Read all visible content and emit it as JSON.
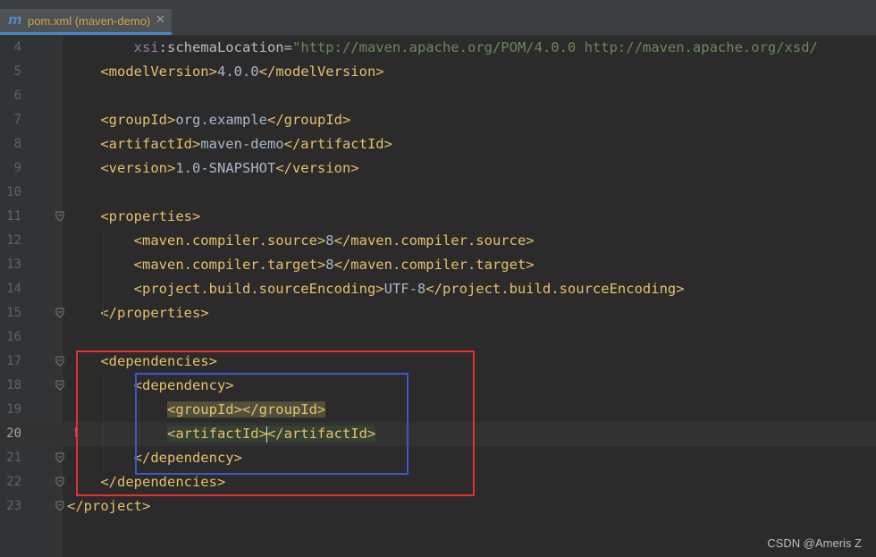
{
  "tab": {
    "icon": "m",
    "title": "pom.xml (maven-demo)",
    "close": "✕"
  },
  "lines": [
    {
      "n": "4",
      "parts": [
        [
          "ns",
          "        xsi"
        ],
        [
          "attr",
          ":schemaLocation"
        ],
        [
          "txt",
          "="
        ],
        [
          "str",
          "\"http://maven.apache.org/POM/4.0.0 http://maven.apache.org/xsd/"
        ]
      ]
    },
    {
      "n": "5",
      "parts": [
        [
          "tag",
          "    <modelVersion>"
        ],
        [
          "txt",
          "4.0.0"
        ],
        [
          "tag",
          "</modelVersion>"
        ]
      ]
    },
    {
      "n": "6",
      "parts": []
    },
    {
      "n": "7",
      "parts": [
        [
          "tag",
          "    <groupId>"
        ],
        [
          "txt",
          "org.example"
        ],
        [
          "tag",
          "</groupId>"
        ]
      ]
    },
    {
      "n": "8",
      "parts": [
        [
          "tag",
          "    <artifactId>"
        ],
        [
          "txt",
          "maven-demo"
        ],
        [
          "tag",
          "</artifactId>"
        ]
      ]
    },
    {
      "n": "9",
      "parts": [
        [
          "tag",
          "    <version>"
        ],
        [
          "txt",
          "1.0-SNAPSHOT"
        ],
        [
          "tag",
          "</version>"
        ]
      ]
    },
    {
      "n": "10",
      "parts": []
    },
    {
      "n": "11",
      "parts": [
        [
          "tag",
          "    <properties>"
        ]
      ]
    },
    {
      "n": "12",
      "parts": [
        [
          "tag",
          "        <maven.compiler.source>"
        ],
        [
          "txt",
          "8"
        ],
        [
          "tag",
          "</maven.compiler.source>"
        ]
      ]
    },
    {
      "n": "13",
      "parts": [
        [
          "tag",
          "        <maven.compiler.target>"
        ],
        [
          "txt",
          "8"
        ],
        [
          "tag",
          "</maven.compiler.target>"
        ]
      ]
    },
    {
      "n": "14",
      "parts": [
        [
          "tag",
          "        <project.build.sourceEncoding>"
        ],
        [
          "txt",
          "UTF-8"
        ],
        [
          "tag",
          "</project.build.sourceEncoding>"
        ]
      ]
    },
    {
      "n": "15",
      "parts": [
        [
          "tag",
          "    </properties>"
        ]
      ]
    },
    {
      "n": "16",
      "parts": []
    },
    {
      "n": "17",
      "parts": [
        [
          "tag",
          "    <dependencies>"
        ]
      ]
    },
    {
      "n": "18",
      "parts": [
        [
          "tag",
          "        <dependency>"
        ]
      ]
    },
    {
      "n": "19",
      "parts": [
        [
          "txt",
          "            "
        ],
        [
          "tag hl1",
          "<groupId></groupId>"
        ]
      ]
    },
    {
      "n": "20",
      "parts": [
        [
          "txt",
          "            "
        ],
        [
          "tag hl2",
          "<artifactId>"
        ],
        [
          "caret",
          ""
        ],
        [
          "tag hl2",
          "</artifactId>"
        ]
      ]
    },
    {
      "n": "21",
      "parts": [
        [
          "tag",
          "        </dependency>"
        ]
      ]
    },
    {
      "n": "22",
      "parts": [
        [
          "tag",
          "    </dependencies>"
        ]
      ]
    },
    {
      "n": "23",
      "parts": [
        [
          "tag",
          "</project>"
        ]
      ]
    }
  ],
  "active_line": "20",
  "fold_lines": [
    "11",
    "15",
    "17",
    "18",
    "21",
    "22",
    "23"
  ],
  "error_line": "20",
  "watermark": "CSDN @Ameris Z"
}
